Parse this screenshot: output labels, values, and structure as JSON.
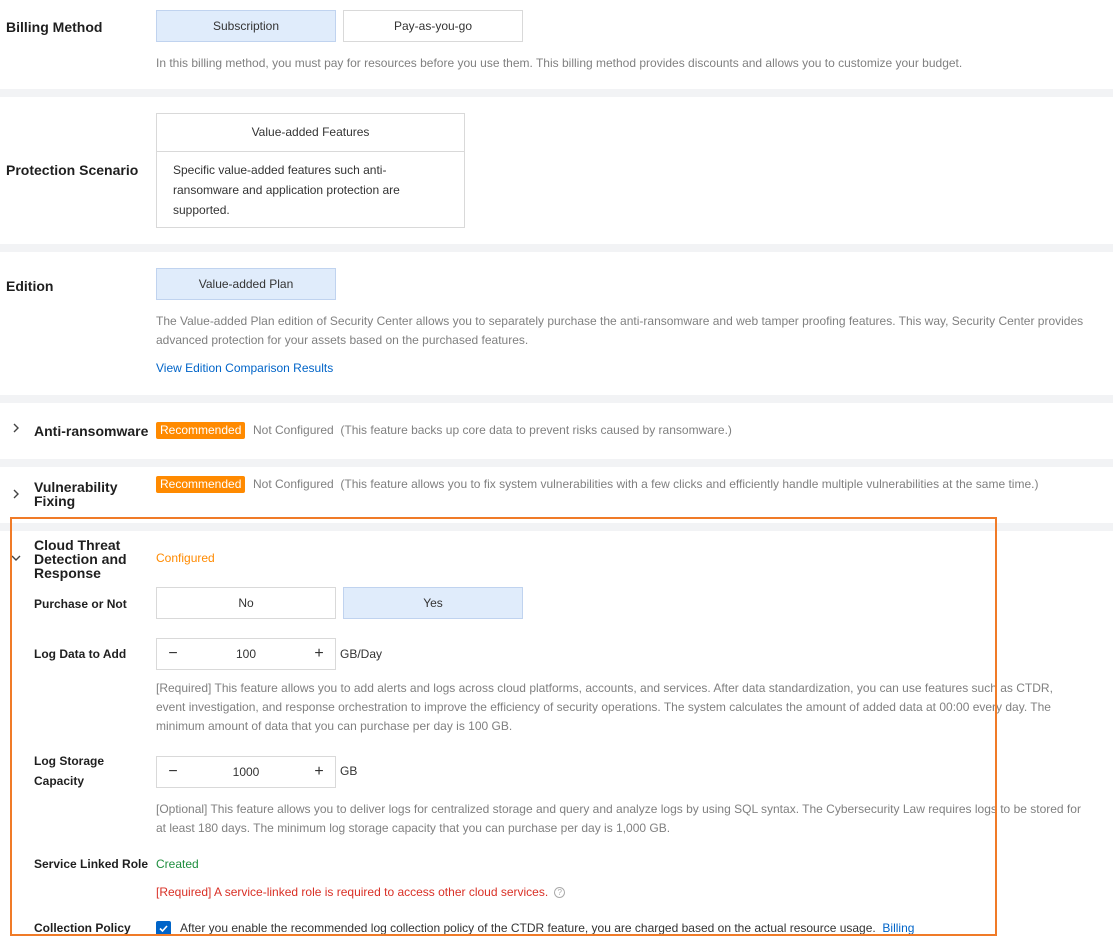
{
  "billing": {
    "label": "Billing Method",
    "options": [
      "Subscription",
      "Pay-as-you-go"
    ],
    "selected": "Subscription",
    "description": "In this billing method, you must pay for resources before you use them. This billing method provides discounts and allows you to customize your budget."
  },
  "scenario": {
    "label": "Protection Scenario",
    "card_title": "Value-added Features",
    "card_body": "Specific value-added features such anti-ransomware and application protection are supported."
  },
  "edition": {
    "label": "Edition",
    "option": "Value-added Plan",
    "description": "The Value-added Plan edition of Security Center allows you to separately purchase the anti-ransomware and web tamper proofing features. This way, Security Center provides advanced protection for your assets based on the purchased features.",
    "link": "View Edition Comparison Results"
  },
  "anti_ransomware": {
    "label": "Anti-ransomware",
    "badge": "Recommended",
    "status": "Not Configured",
    "note": "(This feature backs up core data to prevent risks caused by ransomware.)"
  },
  "vuln": {
    "label_line1": "Vulnerability",
    "label_line2": "Fixing",
    "badge": "Recommended",
    "status": "Not Configured",
    "note": "(This feature allows you to fix system vulnerabilities with a few clicks and efficiently handle multiple vulnerabilities at the same time.)"
  },
  "ctdr": {
    "label_line1": "Cloud Threat",
    "label_line2": "Detection and",
    "label_line3": "Response",
    "status": "Configured",
    "purchase_label": "Purchase or Not",
    "purchase_options": [
      "No",
      "Yes"
    ],
    "purchase_selected": "Yes",
    "log_data_label": "Log Data to Add",
    "log_data_value": "100",
    "log_data_unit": "GB/Day",
    "log_data_desc": "[Required] This feature allows you to add alerts and logs across cloud platforms, accounts, and services. After data standardization, you can use features such as CTDR, event investigation, and response orchestration to improve the efficiency of security operations. The system calculates the amount of added data at 00:00 every day. The minimum amount of data that you can purchase per day is 100 GB.",
    "log_storage_label_line1": "Log Storage",
    "log_storage_label_line2": "Capacity",
    "log_storage_value": "1000",
    "log_storage_unit": "GB",
    "log_storage_desc": "[Optional] This feature allows you to deliver logs for centralized storage and query and analyze logs by using SQL syntax. The Cybersecurity Law requires logs to be stored for at least 180 days. The minimum log storage capacity that you can purchase per day is 1,000 GB.",
    "role_label": "Service Linked Role",
    "role_status": "Created",
    "role_note": "[Required] A service-linked role is required to access other cloud services.",
    "policy_label": "Collection Policy",
    "policy_text": "After you enable the recommended log collection policy of the CTDR feature, you are charged based on the actual resource usage.",
    "policy_link": "Billing"
  },
  "colors": {
    "accent": "#0064c8",
    "badge": "#ff8a00",
    "configured": "#ff8a00",
    "created": "#1e8e3e",
    "required_red": "#d93026",
    "highlight_border": "#f07b28"
  }
}
